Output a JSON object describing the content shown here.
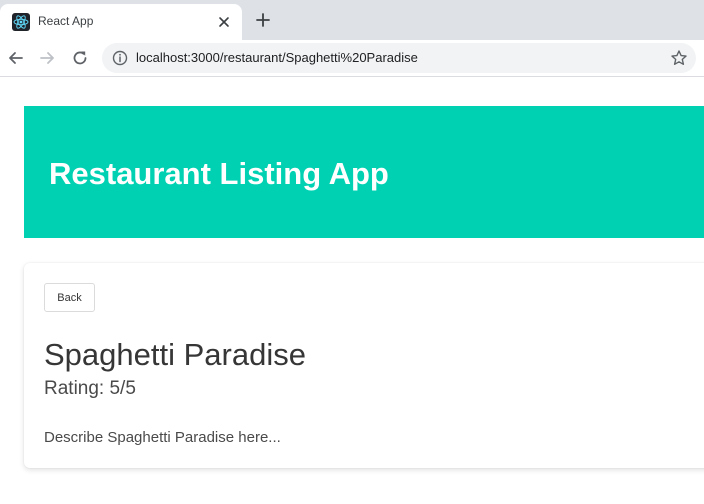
{
  "browser": {
    "tab": {
      "title": "React App",
      "favicon": "react-logo-icon"
    },
    "url": "localhost:3000/restaurant/Spaghetti%20Paradise",
    "icons": {
      "back": "arrow-left-icon",
      "forward": "arrow-right-icon",
      "reload": "reload-icon",
      "info": "info-icon",
      "bookmark": "star-icon",
      "close_tab": "close-icon",
      "new_tab": "plus-icon"
    }
  },
  "page": {
    "hero": {
      "title": "Restaurant Listing App",
      "color": "#00d1b2"
    },
    "detail": {
      "back_label": "Back",
      "name": "Spaghetti Paradise",
      "rating": "Rating: 5/5",
      "description": "Describe Spaghetti Paradise here..."
    }
  }
}
